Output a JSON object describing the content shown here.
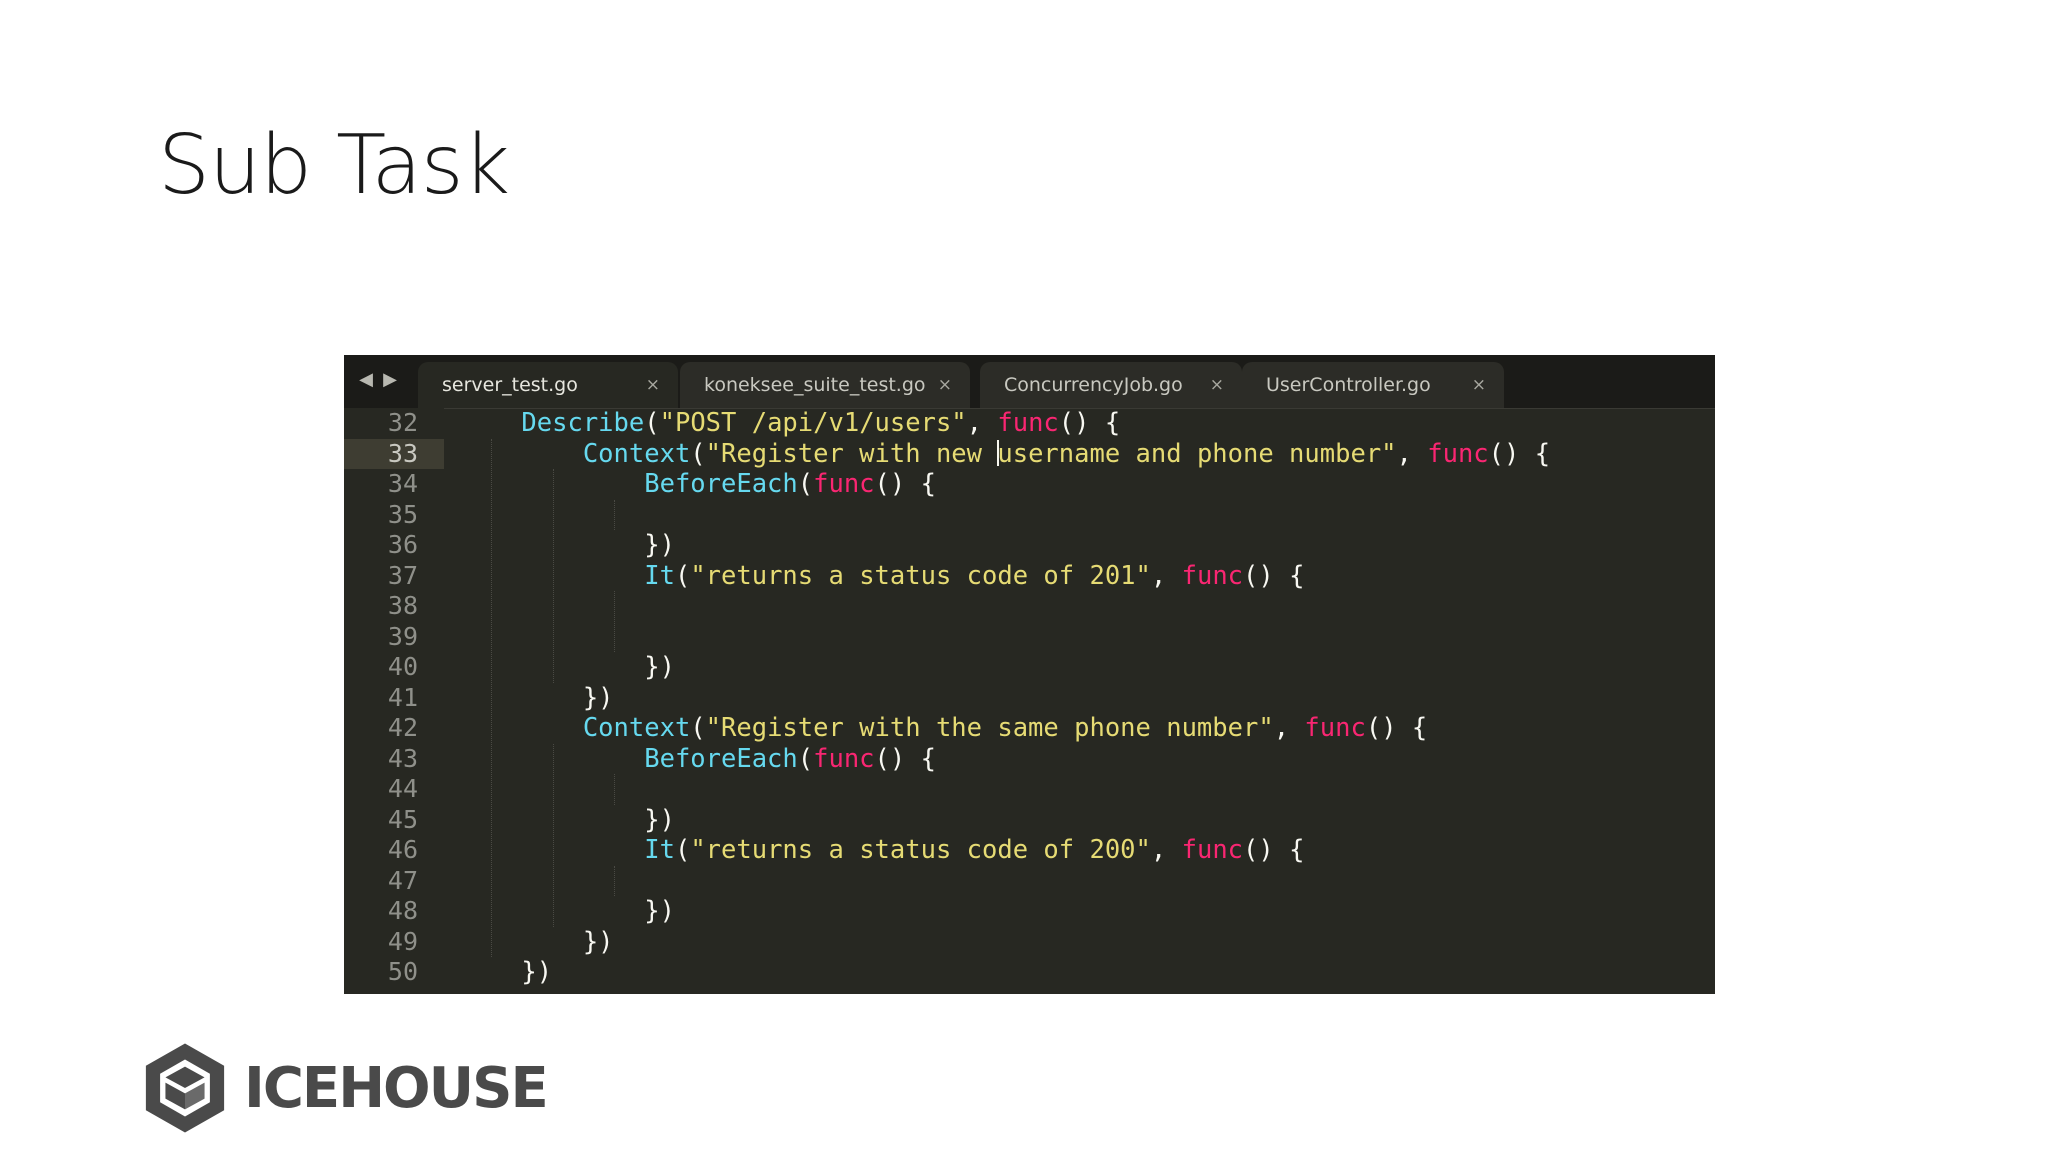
{
  "slide": {
    "title": "Sub Task"
  },
  "editor": {
    "nav": {
      "back": "◀",
      "forward": "▶"
    },
    "tabs": [
      {
        "label": "server_test.go",
        "close": "×",
        "active": true
      },
      {
        "label": "koneksee_suite_test.go",
        "close": "×",
        "active": false
      },
      {
        "label": "ConcurrencyJob.go",
        "close": "×",
        "active": false
      },
      {
        "label": "UserController.go",
        "close": "×",
        "active": false
      }
    ],
    "current_line": "33",
    "lines": [
      {
        "num": "32",
        "indent": "    ",
        "tokens": [
          [
            "fn",
            "Describe"
          ],
          [
            "p",
            "("
          ],
          [
            "str",
            "\"POST /api/v1/users\""
          ],
          [
            "p",
            ", "
          ],
          [
            "kw",
            "func"
          ],
          [
            "p",
            "() {"
          ]
        ]
      },
      {
        "num": "33",
        "indent": "        ",
        "tokens": [
          [
            "fn",
            "Context"
          ],
          [
            "p",
            "("
          ],
          [
            "str",
            "\"Register with new "
          ],
          [
            "caret",
            ""
          ],
          [
            "str",
            "username and phone number\""
          ],
          [
            "p",
            ", "
          ],
          [
            "kw",
            "func"
          ],
          [
            "p",
            "() {"
          ]
        ]
      },
      {
        "num": "34",
        "indent": "            ",
        "tokens": [
          [
            "fn",
            "BeforeEach"
          ],
          [
            "p",
            "("
          ],
          [
            "kw",
            "func"
          ],
          [
            "p",
            "() {"
          ]
        ]
      },
      {
        "num": "35",
        "indent": "",
        "tokens": []
      },
      {
        "num": "36",
        "indent": "            ",
        "tokens": [
          [
            "p",
            "})"
          ]
        ]
      },
      {
        "num": "37",
        "indent": "            ",
        "tokens": [
          [
            "fn",
            "It"
          ],
          [
            "p",
            "("
          ],
          [
            "str",
            "\"returns a status code of 201\""
          ],
          [
            "p",
            ", "
          ],
          [
            "kw",
            "func"
          ],
          [
            "p",
            "() {"
          ]
        ]
      },
      {
        "num": "38",
        "indent": "",
        "tokens": []
      },
      {
        "num": "39",
        "indent": "",
        "tokens": []
      },
      {
        "num": "40",
        "indent": "            ",
        "tokens": [
          [
            "p",
            "})"
          ]
        ]
      },
      {
        "num": "41",
        "indent": "        ",
        "tokens": [
          [
            "p",
            "})"
          ]
        ]
      },
      {
        "num": "42",
        "indent": "        ",
        "tokens": [
          [
            "fn",
            "Context"
          ],
          [
            "p",
            "("
          ],
          [
            "str",
            "\"Register with the same phone number\""
          ],
          [
            "p",
            ", "
          ],
          [
            "kw",
            "func"
          ],
          [
            "p",
            "() {"
          ]
        ]
      },
      {
        "num": "43",
        "indent": "            ",
        "tokens": [
          [
            "fn",
            "BeforeEach"
          ],
          [
            "p",
            "("
          ],
          [
            "kw",
            "func"
          ],
          [
            "p",
            "() {"
          ]
        ]
      },
      {
        "num": "44",
        "indent": "",
        "tokens": []
      },
      {
        "num": "45",
        "indent": "            ",
        "tokens": [
          [
            "p",
            "})"
          ]
        ]
      },
      {
        "num": "46",
        "indent": "            ",
        "tokens": [
          [
            "fn",
            "It"
          ],
          [
            "p",
            "("
          ],
          [
            "str",
            "\"returns a status code of 200\""
          ],
          [
            "p",
            ", "
          ],
          [
            "kw",
            "func"
          ],
          [
            "p",
            "() {"
          ]
        ]
      },
      {
        "num": "47",
        "indent": "",
        "tokens": []
      },
      {
        "num": "48",
        "indent": "            ",
        "tokens": [
          [
            "p",
            "})"
          ]
        ]
      },
      {
        "num": "49",
        "indent": "        ",
        "tokens": [
          [
            "p",
            "})"
          ]
        ]
      },
      {
        "num": "50",
        "indent": "    ",
        "tokens": [
          [
            "p",
            "})"
          ]
        ]
      }
    ]
  },
  "logo": {
    "text": "ICEHOUSE",
    "icon": "icehouse-hexagon-icon"
  },
  "colors": {
    "background": "#272822",
    "function": "#66d9ef",
    "string": "#e6db74",
    "keyword": "#f92672",
    "plain": "#f8f8f2"
  }
}
